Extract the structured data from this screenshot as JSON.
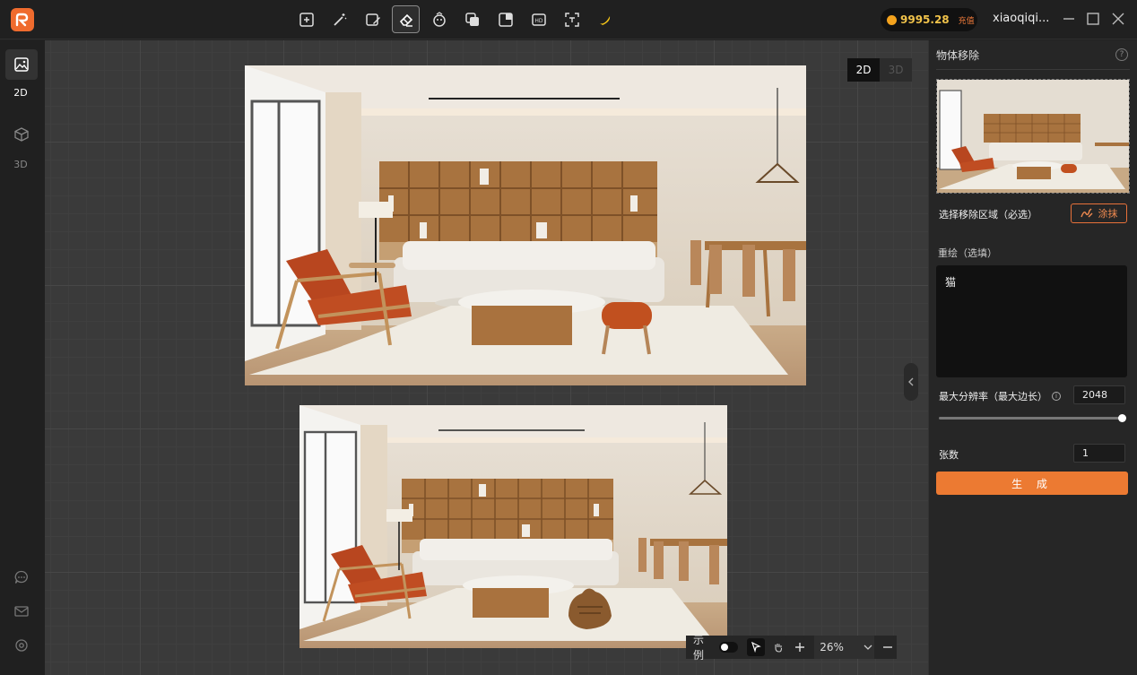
{
  "topbar": {
    "tools": [
      "expand-image-icon",
      "magic-wand-icon",
      "image-edit-icon",
      "eraser-icon",
      "face-swap-icon",
      "layers-icon",
      "crop-icon",
      "hd-icon",
      "scan-text-icon",
      "banana-icon"
    ],
    "active_tool": "eraser-icon",
    "credits": "9995.28",
    "recharge_label": "充值",
    "username": "xiaoqiqi..."
  },
  "leftrail": {
    "items": [
      {
        "label": "2D",
        "icon": "image-icon",
        "active": true
      },
      {
        "label": "3D",
        "icon": "cube-icon",
        "active": false
      }
    ],
    "bottom_icons": [
      "chat-icon",
      "mail-icon",
      "settings-icon"
    ]
  },
  "canvas": {
    "mode_2d": "2D",
    "mode_3d": "3D",
    "active_mode": "2D",
    "example_label": "示例",
    "zoom": "26%"
  },
  "panel": {
    "title": "物体移除",
    "help": "?",
    "select_label": "选择移除区域（必选）",
    "smear_label": "涂抹",
    "redraw_label": "重绘（选填）",
    "redraw_text": "猫",
    "resolution_label": "最大分辨率（最大边长）",
    "resolution_value": "2048",
    "resolution_fraction": 1.0,
    "count_label": "张数",
    "count_value": "1",
    "generate_label": "生 成"
  },
  "colors": {
    "accent": "#ec7a32",
    "sofa": "#e9e4dc",
    "chair": "#b8461f",
    "wood": "#a8733f"
  }
}
